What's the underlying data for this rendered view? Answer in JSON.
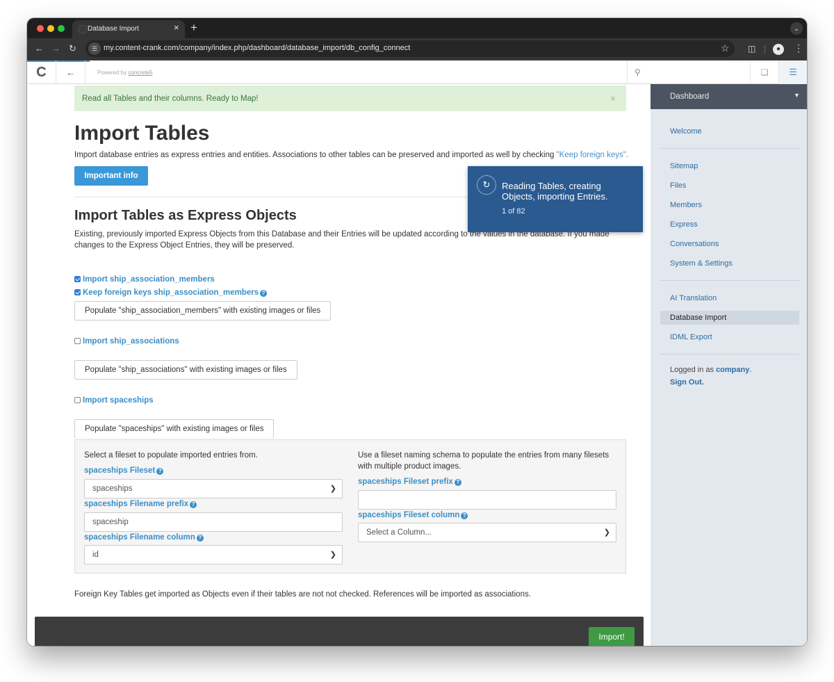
{
  "browser": {
    "tab_title": "Database Import",
    "tab_close": "×",
    "new_tab": "+",
    "url": "my.content-crank.com/company/index.php/dashboard/database_import/db_config_connect",
    "icons": [
      "back-arrow-icon",
      "forward-arrow-icon",
      "reload-icon",
      "site-info-icon",
      "bookmark-star-icon",
      "extensions-icon",
      "profile-icon",
      "kebab-menu-icon",
      "tab-list-icon"
    ]
  },
  "cms_toolbar": {
    "powered_prefix": "Powered by",
    "powered_link": "concrete5"
  },
  "alert": {
    "message": "Read all Tables and their columns. Ready to Map!",
    "close": "×"
  },
  "toast": {
    "message": "Reading Tables, creating Objects, importing Entries.",
    "progress": "1 of 82"
  },
  "page": {
    "title": "Import Tables",
    "intro_before": "Import database entries as express entries and entities. Associations to other tables can be preserved and imported as well by checking ",
    "intro_hint": "\"Keep foreign keys\".",
    "info_button": "Important info",
    "section_title": "Import Tables as Express Objects",
    "section_text": "Existing, previously imported Express Objects from this Database and their Entries will be updated according to the values in the database. If you made changes to the Express Object Entries, they will be preserved.",
    "footnote": "Foreign Key Tables get imported as Objects even if their tables are not not checked. References will be imported as associations.",
    "import_button": "Import!"
  },
  "tables": [
    {
      "import_label": "Import ship_association_members",
      "import_checked": true,
      "keep_fk_label": "Keep foreign keys ship_association_members",
      "keep_fk_checked": true,
      "populate_button": "Populate \"ship_association_members\" with existing images or files"
    },
    {
      "import_label": "Import ship_associations",
      "import_checked": false,
      "populate_button": "Populate \"ship_associations\" with existing images or files"
    },
    {
      "import_label": "Import spaceships",
      "import_checked": false,
      "populate_button": "Populate \"spaceships\" with existing images or files"
    }
  ],
  "populate_panel": {
    "left_intro": "Select a fileset to populate imported entries from.",
    "fileset_label": "spaceships Fileset",
    "fileset_value": "spaceships",
    "filename_prefix_label": "spaceships Filename prefix",
    "filename_prefix_value": "spaceship",
    "filename_column_label": "spaceships Filename column",
    "filename_column_value": "id",
    "right_intro": "Use a fileset naming schema to populate the entries from many filesets with multiple product images.",
    "fileset_prefix_label": "spaceships Fileset prefix",
    "fileset_prefix_value": "",
    "fileset_column_label": "spaceships Fileset column",
    "fileset_column_value": "Select a Column..."
  },
  "sidebar": {
    "header": "Dashboard",
    "group1": [
      "Welcome"
    ],
    "group2": [
      "Sitemap",
      "Files",
      "Members",
      "Express",
      "Conversations",
      "System & Settings"
    ],
    "group3": [
      "AI Translation",
      "Database Import",
      "IDML Export"
    ],
    "active_item": "Database Import",
    "logged_in_prefix": "Logged in as",
    "logged_in_user": "company",
    "logged_in_suffix": ".",
    "sign_out": "Sign Out."
  },
  "colors": {
    "primary_button": "#3a98d8",
    "success_button": "#3e9a43",
    "alert_background": "#dff0d8",
    "toast_background": "#2a5a90",
    "link_blue": "#3a8fc8"
  }
}
